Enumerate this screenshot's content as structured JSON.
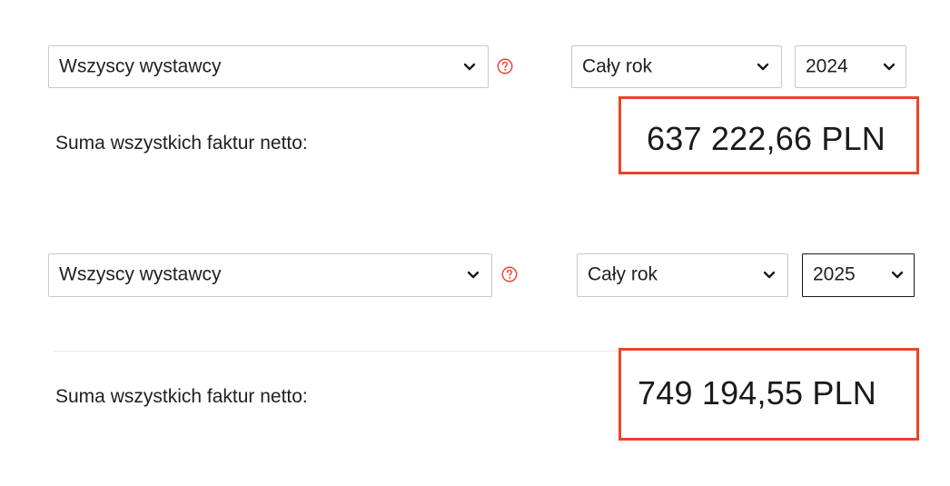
{
  "colors": {
    "highlight": "#e8452a",
    "help_icon": "#e8452a",
    "divider": "#e6e6e6"
  },
  "sections": [
    {
      "issuer_select": "Wszyscy wystawcy",
      "period_select": "Cały rok",
      "year_select": "2024",
      "summary_label": "Suma wszystkich faktur netto:",
      "total": "637 222,66 PLN"
    },
    {
      "issuer_select": "Wszyscy wystawcy",
      "period_select": "Cały rok",
      "year_select": "2025",
      "summary_label": "Suma wszystkich faktur netto:",
      "total": "749 194,55 PLN"
    }
  ]
}
